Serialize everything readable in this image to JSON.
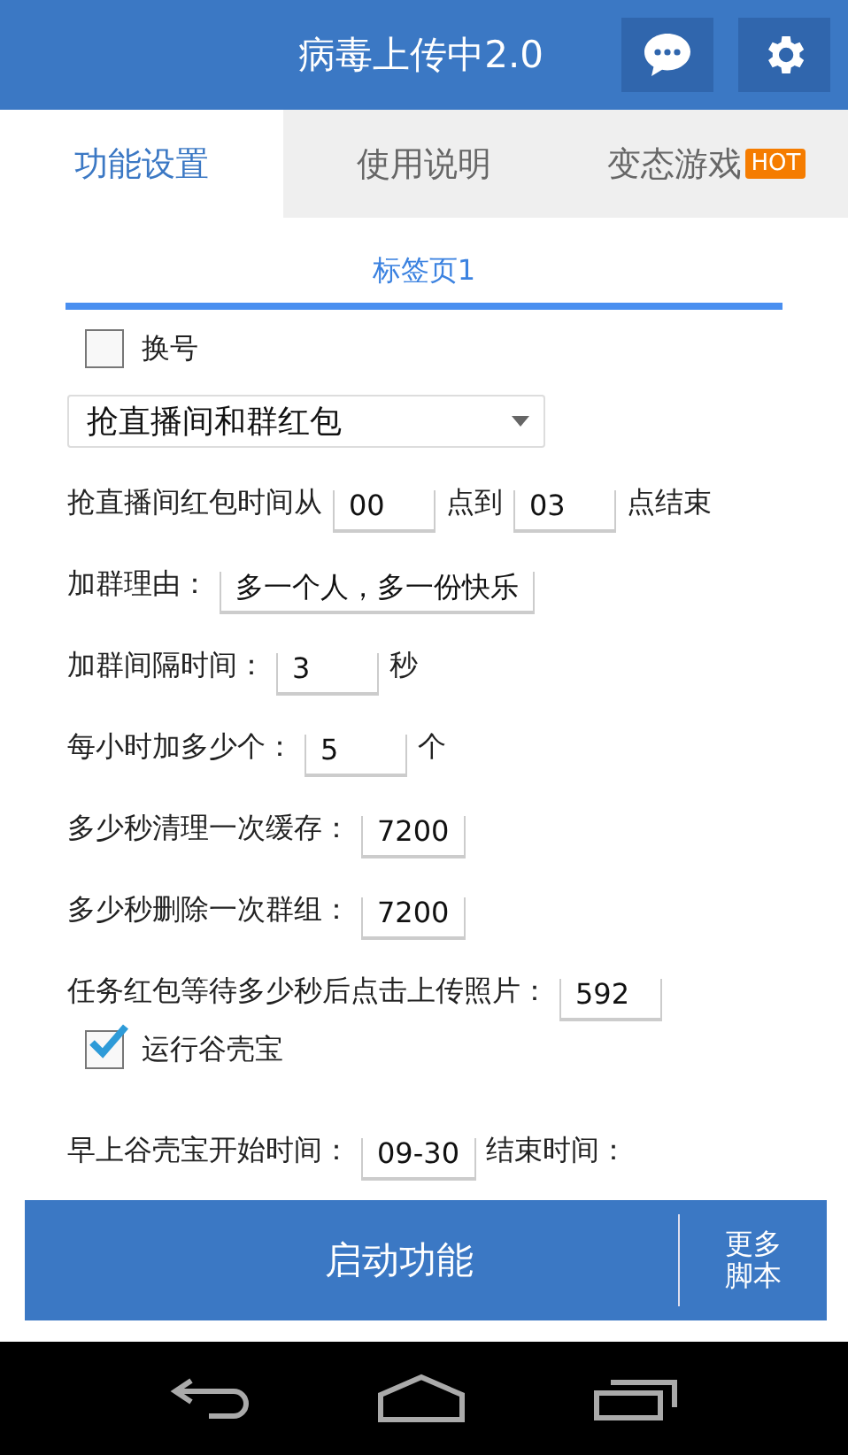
{
  "app_bar": {
    "title": "病毒上传中2.0"
  },
  "tabs": [
    {
      "label": "功能设置",
      "selected": true
    },
    {
      "label": "使用说明",
      "selected": false
    },
    {
      "label": "变态游戏",
      "selected": false,
      "badge": "HOT"
    }
  ],
  "sub_tab": {
    "label": "标签页1"
  },
  "form": [
    {
      "kind": "checkbox",
      "label": "换号",
      "checked": false
    },
    {
      "kind": "dropdown",
      "value": "抢直播间和群红包"
    },
    {
      "kind": "fields",
      "parts": [
        {
          "kind": "text",
          "text": "抢直播间红包时间从"
        },
        {
          "kind": "input",
          "value": "00"
        },
        {
          "kind": "text",
          "text": "点到"
        },
        {
          "kind": "input",
          "value": "03"
        },
        {
          "kind": "text",
          "text": "点结束"
        }
      ]
    },
    {
      "kind": "fields",
      "parts": [
        {
          "kind": "text",
          "text": "加群理由："
        },
        {
          "kind": "input",
          "value": "多一个人，多一份快乐"
        }
      ]
    },
    {
      "kind": "fields",
      "parts": [
        {
          "kind": "text",
          "text": "加群间隔时间："
        },
        {
          "kind": "input",
          "value": "3"
        },
        {
          "kind": "text",
          "text": "秒"
        }
      ]
    },
    {
      "kind": "fields",
      "parts": [
        {
          "kind": "text",
          "text": "每小时加多少个："
        },
        {
          "kind": "input",
          "value": "5"
        },
        {
          "kind": "text",
          "text": "个"
        }
      ]
    },
    {
      "kind": "fields",
      "parts": [
        {
          "kind": "text",
          "text": "多少秒清理一次缓存："
        },
        {
          "kind": "input",
          "value": "7200"
        }
      ]
    },
    {
      "kind": "fields",
      "parts": [
        {
          "kind": "text",
          "text": "多少秒删除一次群组："
        },
        {
          "kind": "input",
          "value": "7200"
        }
      ]
    },
    {
      "kind": "fields",
      "parts": [
        {
          "kind": "text",
          "text": "任务红包等待多少秒后点击上传照片："
        },
        {
          "kind": "input",
          "value": "592"
        }
      ]
    },
    {
      "kind": "checkbox",
      "label": "运行谷壳宝",
      "checked": true
    },
    {
      "kind": "fields",
      "parts": [
        {
          "kind": "text",
          "text": "早上谷壳宝开始时间："
        },
        {
          "kind": "input",
          "value": "09-30"
        },
        {
          "kind": "text",
          "text": "结束时间："
        }
      ]
    }
  ],
  "actions": {
    "primary": "启动功能",
    "secondary": "更多脚本"
  }
}
